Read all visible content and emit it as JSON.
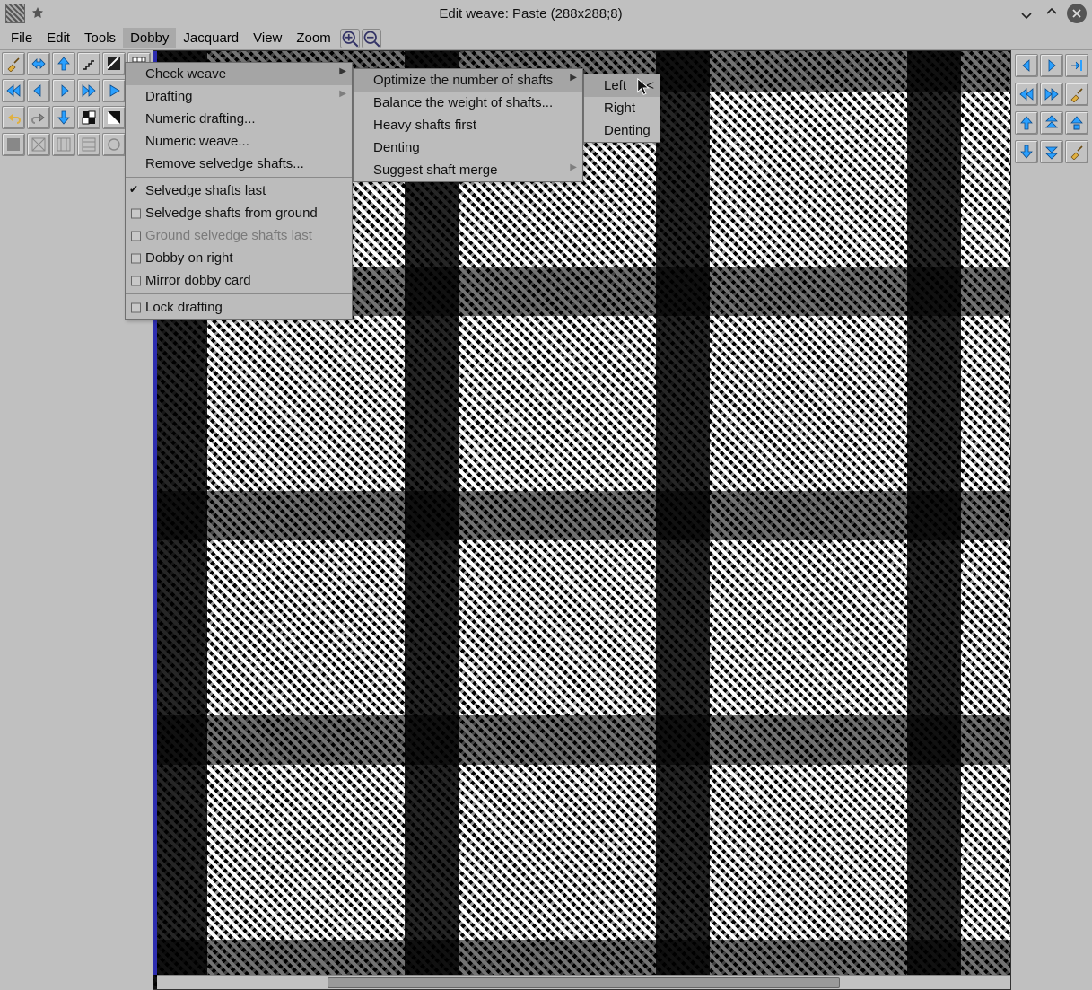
{
  "window": {
    "title": "Edit weave: Paste (288x288;8)"
  },
  "menubar": {
    "items": [
      "File",
      "Edit",
      "Tools",
      "Dobby",
      "Jacquard",
      "View",
      "Zoom"
    ],
    "active_index": 3,
    "zoom_in_icon": "zoom-in",
    "zoom_out_icon": "zoom-out"
  },
  "dobby_menu": {
    "items": [
      {
        "label": "Check weave",
        "submenu": true,
        "highlight": true
      },
      {
        "label": "Drafting",
        "submenu": true
      },
      {
        "label": "Numeric drafting..."
      },
      {
        "label": "Numeric weave..."
      },
      {
        "label": "Remove selvedge shafts..."
      },
      {
        "sep": true
      },
      {
        "label": "Selvedge shafts last",
        "checked": true
      },
      {
        "label": "Selvedge shafts from ground",
        "checkbox": true
      },
      {
        "label": "Ground selvedge shafts last",
        "checkbox": true,
        "disabled": true
      },
      {
        "label": "Dobby on right",
        "checkbox": true
      },
      {
        "label": "Mirror dobby card",
        "checkbox": true
      },
      {
        "sep": true
      },
      {
        "label": "Lock drafting",
        "checkbox": true
      }
    ]
  },
  "check_menu": {
    "items": [
      {
        "label": "Optimize the number of shafts",
        "submenu": true,
        "highlight": true
      },
      {
        "label": "Balance the weight of shafts..."
      },
      {
        "label": "Heavy shafts first"
      },
      {
        "label": "Denting"
      },
      {
        "label": "Suggest shaft merge",
        "submenu": true
      }
    ]
  },
  "optimize_menu": {
    "items": [
      {
        "label": "Left",
        "highlight": true,
        "ext": "<"
      },
      {
        "label": "Right"
      },
      {
        "label": "Denting"
      }
    ]
  },
  "left_toolbar": {
    "rows": [
      [
        "brush",
        "mirror-h",
        "arrow-up",
        "stairs-up",
        "stairs-pattern",
        "grid",
        "arrow-left-double"
      ],
      [
        "arrow-left-l",
        "arrow-left",
        "arrow-right",
        "arrow-right-r",
        "arrow-right-double",
        "broom"
      ],
      [
        "undo",
        "redo",
        "arrow-down",
        "checker",
        "invert",
        "pattern-a",
        "broom"
      ],
      [
        "pattern-1",
        "pattern-2",
        "pattern-3",
        "pattern-4",
        "pattern-5",
        "pattern-6",
        "broom"
      ]
    ]
  },
  "right_toolbar": {
    "rows": [
      [
        "arrow-left",
        "arrow-right",
        "goto"
      ],
      [
        "arrow-left-double",
        "arrow-right-double",
        "broom"
      ],
      [
        "arrow-up",
        "arrows-up",
        "arrow-up-box"
      ],
      [
        "arrow-down",
        "arrows-down",
        "broom"
      ]
    ]
  }
}
